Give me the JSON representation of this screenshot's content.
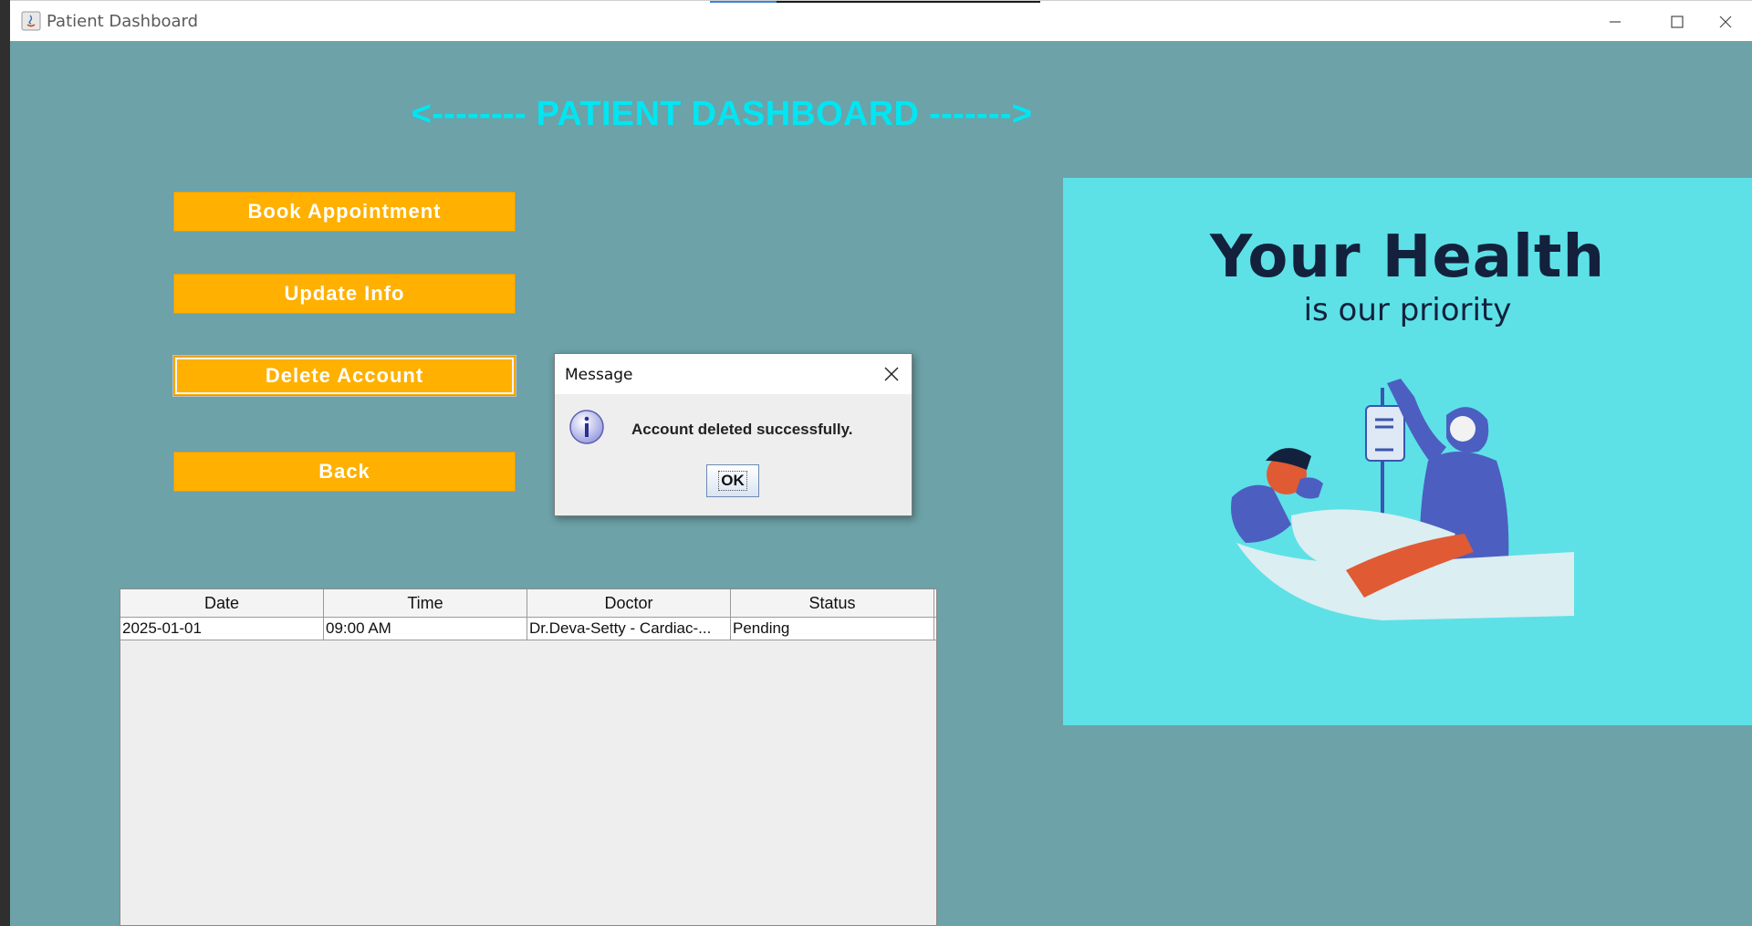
{
  "window": {
    "title": "Patient Dashboard"
  },
  "heading": "<-------- PATIENT DASHBOARD ------->",
  "actions": {
    "book_appointment": "Book Appointment",
    "update_info": "Update Info",
    "delete_account": "Delete Account",
    "back": "Back"
  },
  "table": {
    "columns": [
      "Date",
      "Time",
      "Doctor",
      "Status"
    ],
    "rows": [
      [
        "2025-01-01",
        "09:00 AM",
        "Dr.Deva-Setty - Cardiac-...",
        "Pending"
      ]
    ]
  },
  "banner": {
    "title": "Your Health",
    "subtitle": "is our priority"
  },
  "dialog": {
    "title": "Message",
    "message": "Account deleted successfully.",
    "ok_label": "OK"
  },
  "colors": {
    "background": "#6ca2a8",
    "heading": "#00e6f2",
    "button": "#ffb000",
    "banner": "#5de1e6"
  }
}
